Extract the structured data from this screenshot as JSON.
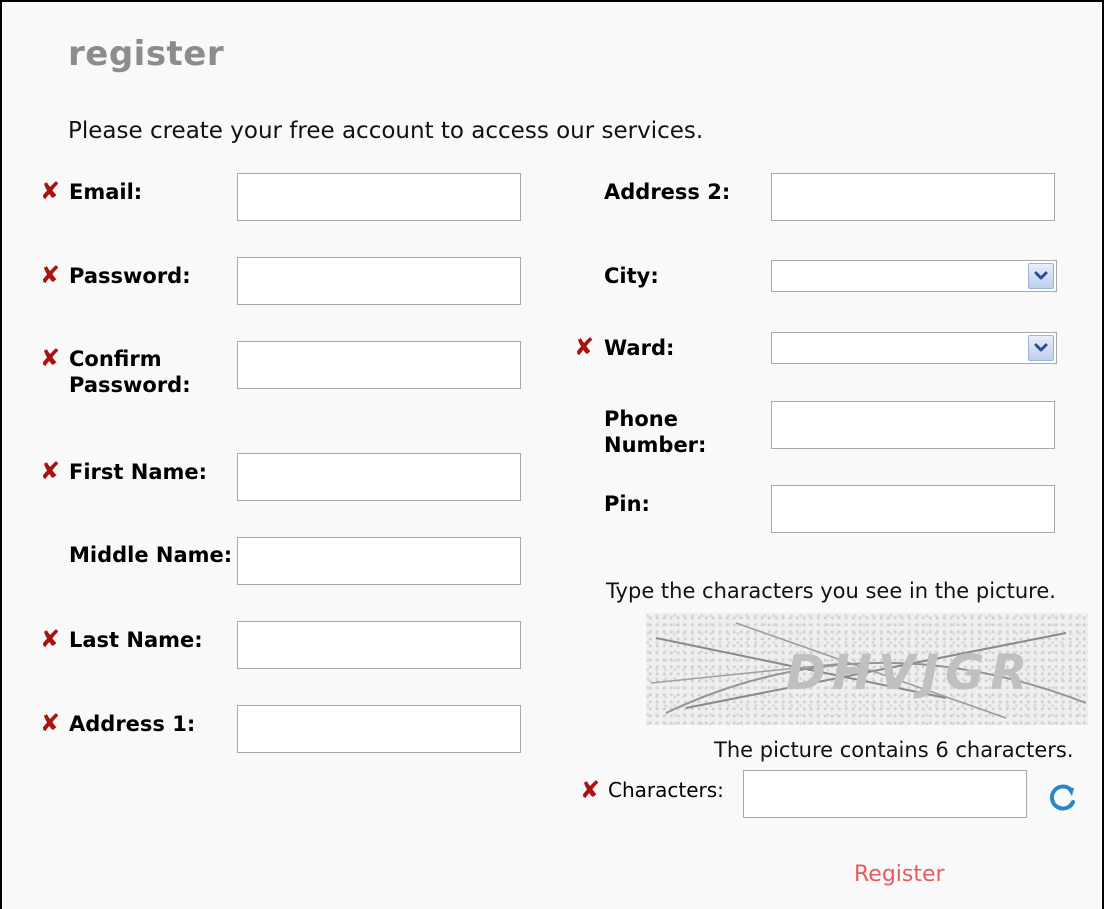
{
  "page": {
    "title": "register",
    "intro": "Please create your free account to access our services."
  },
  "left_fields": [
    {
      "label": "Email:",
      "required": true,
      "value": ""
    },
    {
      "label": "Password:",
      "required": true,
      "value": ""
    },
    {
      "label_line1": "Confirm",
      "label_line2": "Password:",
      "required": true,
      "value": ""
    },
    {
      "label": "First Name:",
      "required": true,
      "value": ""
    },
    {
      "label": "Middle Name:",
      "required": false,
      "value": ""
    },
    {
      "label": "Last Name:",
      "required": true,
      "value": ""
    },
    {
      "label": "Address 1:",
      "required": true,
      "value": ""
    }
  ],
  "right_fields": {
    "address2": {
      "label": "Address 2:",
      "value": ""
    },
    "city": {
      "label": "City:",
      "selected": ""
    },
    "ward": {
      "label": "Ward:",
      "required": true,
      "selected": ""
    },
    "phone": {
      "label_line1": "Phone",
      "label_line2": "Number:",
      "value": ""
    },
    "pin": {
      "label": "Pin:",
      "value": ""
    }
  },
  "captcha": {
    "instruction": "Type the characters you see in the picture.",
    "image_text": "DHVJGR",
    "count_text": "The picture contains 6 characters.",
    "label": "Characters:",
    "value": ""
  },
  "actions": {
    "register_label": "Register"
  },
  "icons": {
    "required_mark": "✘",
    "refresh": "refresh-icon",
    "dropdown": "chevron-down-icon"
  },
  "colors": {
    "title": "#8c8c8c",
    "required_mark": "#aa1111",
    "register_link": "#e65c5c",
    "refresh": "#2a86c9"
  }
}
